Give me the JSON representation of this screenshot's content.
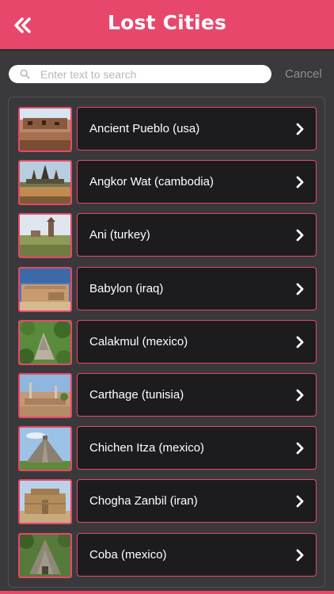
{
  "header": {
    "title": "Lost Cities",
    "back_icon": "double-chevron-left-icon",
    "color": "#e8476c"
  },
  "search": {
    "placeholder": "Enter text to search",
    "value": "",
    "cancel_label": "Cancel"
  },
  "items": [
    {
      "label": "Ancient Pueblo (usa)",
      "thumb": "ancient-pueblo"
    },
    {
      "label": "Angkor Wat (cambodia)",
      "thumb": "angkor-wat"
    },
    {
      "label": "Ani (turkey)",
      "thumb": "ani"
    },
    {
      "label": "Babylon (iraq)",
      "thumb": "babylon"
    },
    {
      "label": "Calakmul (mexico)",
      "thumb": "calakmul"
    },
    {
      "label": "Carthage (tunisia)",
      "thumb": "carthage"
    },
    {
      "label": "Chichen Itza (mexico)",
      "thumb": "chichen-itza"
    },
    {
      "label": "Chogha Zanbil (iran)",
      "thumb": "chogha-zanbil"
    },
    {
      "label": "Coba (mexico)",
      "thumb": "coba"
    }
  ]
}
